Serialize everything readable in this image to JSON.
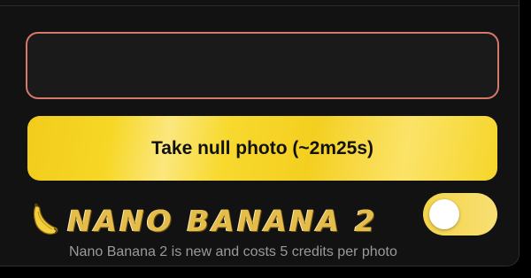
{
  "prompt": {
    "value": "",
    "placeholder": ""
  },
  "take_button": {
    "label": "Take null photo (~2m25s)"
  },
  "nano_banana": {
    "title": "NANO BANANA 2",
    "icon": "banana-icon",
    "toggle_on": true,
    "caption": "Nano Banana 2 is new and costs 5 credits per photo"
  },
  "colors": {
    "panel_bg": "#121212",
    "input_border": "#d57a68",
    "button_gold": "#f6d42a",
    "title_gold": "#e4bc4a",
    "caption_gray": "#9a9a9a"
  }
}
